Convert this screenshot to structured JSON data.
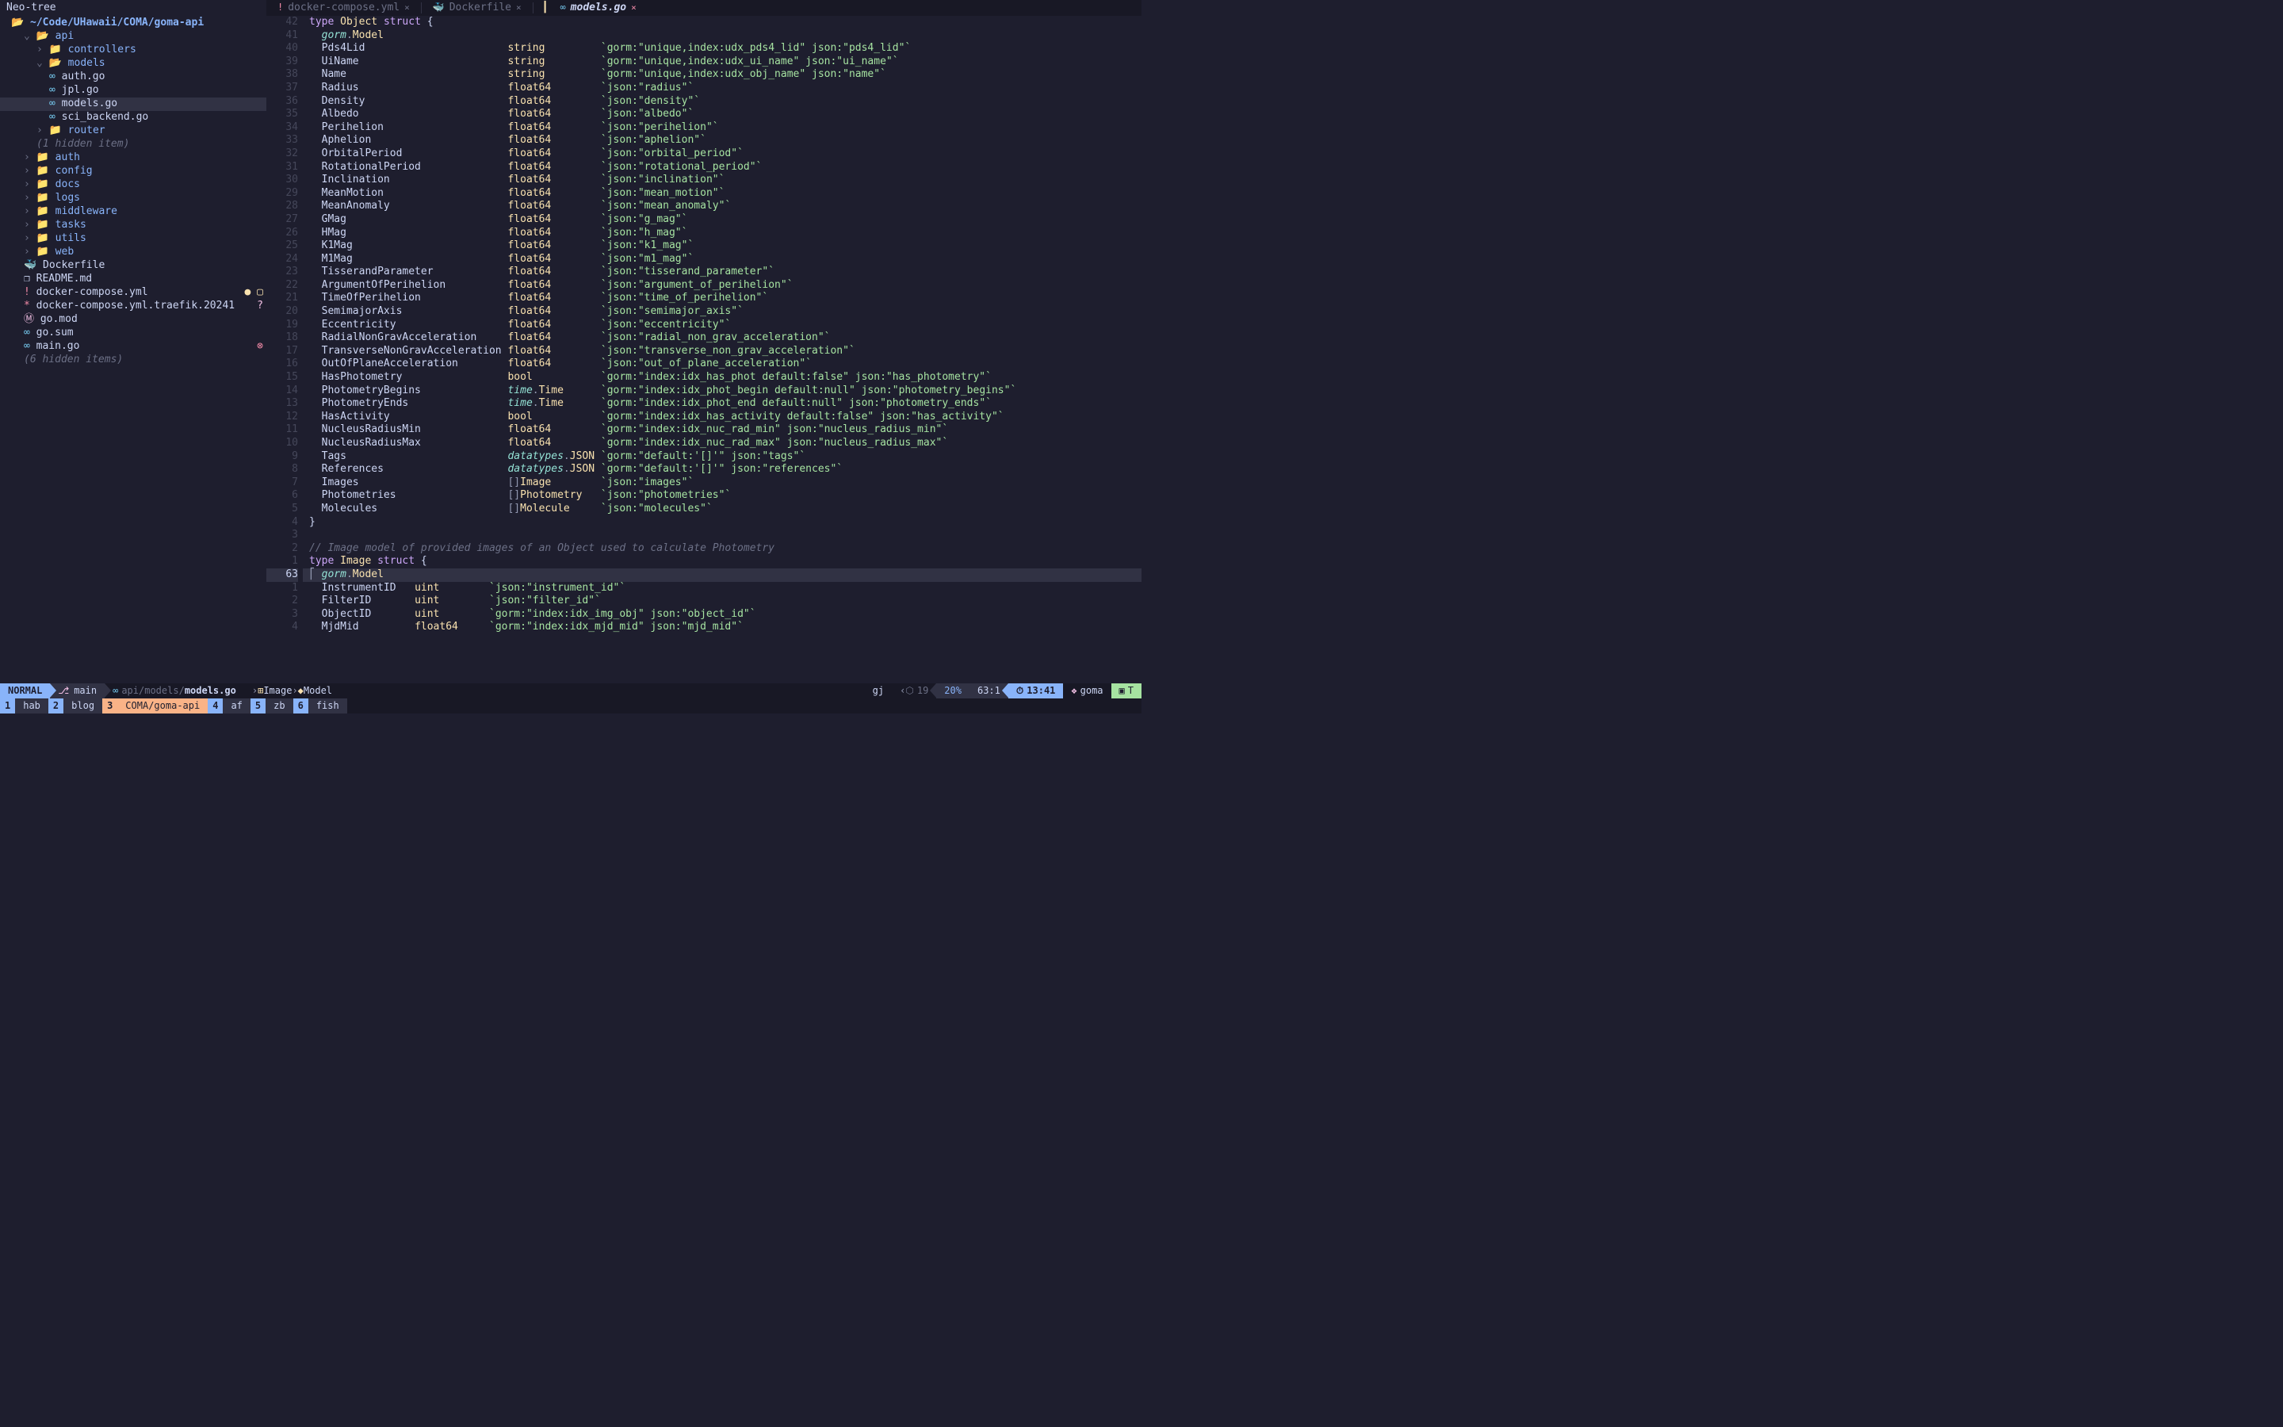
{
  "sidebar": {
    "title": "Neo-tree",
    "root": "~/Code/UHawaii/COMA/goma-api",
    "items": [
      {
        "depth": 1,
        "kind": "folder-open",
        "chev": "v",
        "label": "api"
      },
      {
        "depth": 2,
        "kind": "folder",
        "chev": ">",
        "label": "controllers"
      },
      {
        "depth": 2,
        "kind": "folder-open",
        "chev": "v",
        "label": "models"
      },
      {
        "depth": 3,
        "kind": "go",
        "label": "auth.go"
      },
      {
        "depth": 3,
        "kind": "go",
        "label": "jpl.go"
      },
      {
        "depth": 3,
        "kind": "go",
        "label": "models.go",
        "hl": true
      },
      {
        "depth": 3,
        "kind": "go",
        "label": "sci_backend.go"
      },
      {
        "depth": 2,
        "kind": "folder",
        "chev": ">",
        "label": "router"
      },
      {
        "depth": 2,
        "kind": "muted",
        "label": "(1 hidden item)"
      },
      {
        "depth": 1,
        "kind": "folder",
        "chev": ">",
        "label": "auth"
      },
      {
        "depth": 1,
        "kind": "folder",
        "chev": ">",
        "label": "config"
      },
      {
        "depth": 1,
        "kind": "folder",
        "chev": ">",
        "label": "docs"
      },
      {
        "depth": 1,
        "kind": "folder",
        "chev": ">",
        "label": "logs"
      },
      {
        "depth": 1,
        "kind": "folder",
        "chev": ">",
        "label": "middleware"
      },
      {
        "depth": 1,
        "kind": "folder",
        "chev": ">",
        "label": "tasks"
      },
      {
        "depth": 1,
        "kind": "folder",
        "chev": ">",
        "label": "utils"
      },
      {
        "depth": 1,
        "kind": "folder",
        "chev": ">",
        "label": "web"
      },
      {
        "depth": 1,
        "kind": "docker",
        "label": "Dockerfile"
      },
      {
        "depth": 1,
        "kind": "md",
        "label": "README.md",
        "icon": "❐"
      },
      {
        "depth": 1,
        "kind": "yml",
        "label": "docker-compose.yml",
        "icon": "!",
        "mark": "mod"
      },
      {
        "depth": 1,
        "kind": "yml",
        "label": "docker-compose.yml.traefik.20241",
        "icon": "*",
        "mark": "unt"
      },
      {
        "depth": 1,
        "kind": "mod",
        "label": "go.mod",
        "icon": "Ⓜ"
      },
      {
        "depth": 1,
        "kind": "go",
        "label": "go.sum"
      },
      {
        "depth": 1,
        "kind": "go",
        "label": "main.go",
        "mark": "del"
      },
      {
        "depth": 1,
        "kind": "muted",
        "label": "(6 hidden items)"
      }
    ]
  },
  "tabs": [
    {
      "icon": "!",
      "iconColor": "#f38ba8",
      "name": "docker-compose.yml",
      "close": "×",
      "active": false
    },
    {
      "icon": "🐳",
      "iconColor": "#89b4fa",
      "name": "Dockerfile",
      "close": "×",
      "active": false
    },
    {
      "icon": "∞",
      "iconColor": "#74c7ec",
      "name": "models.go",
      "close": "×",
      "active": true,
      "bar": "▎"
    }
  ],
  "gutter_lines": [
    "42",
    "41",
    "40",
    "39",
    "38",
    "37",
    "36",
    "35",
    "34",
    "33",
    "32",
    "31",
    "30",
    "29",
    "28",
    "27",
    "26",
    "25",
    "24",
    "23",
    "22",
    "21",
    "20",
    "19",
    "18",
    "17",
    "16",
    "15",
    "14",
    "13",
    "12",
    "11",
    "10",
    "9",
    "8",
    "7",
    "6",
    "5",
    "4",
    "3",
    "2",
    "1",
    "63",
    "1",
    "2",
    "3",
    "4"
  ],
  "cursor_line_index": 42,
  "code": {
    "header": "type Object struct {",
    "gorm_model": "gorm.Model",
    "fields": [
      {
        "n": "Pds4Lid",
        "t": "string",
        "tag": "`gorm:\"unique,index:udx_pds4_lid\" json:\"pds4_lid\"`"
      },
      {
        "n": "UiName",
        "t": "string",
        "tag": "`gorm:\"unique,index:udx_ui_name\" json:\"ui_name\"`"
      },
      {
        "n": "Name",
        "t": "string",
        "tag": "`gorm:\"unique,index:udx_obj_name\" json:\"name\"`"
      },
      {
        "n": "Radius",
        "t": "float64",
        "tag": "`json:\"radius\"`"
      },
      {
        "n": "Density",
        "t": "float64",
        "tag": "`json:\"density\"`"
      },
      {
        "n": "Albedo",
        "t": "float64",
        "tag": "`json:\"albedo\"`"
      },
      {
        "n": "Perihelion",
        "t": "float64",
        "tag": "`json:\"perihelion\"`"
      },
      {
        "n": "Aphelion",
        "t": "float64",
        "tag": "`json:\"aphelion\"`"
      },
      {
        "n": "OrbitalPeriod",
        "t": "float64",
        "tag": "`json:\"orbital_period\"`"
      },
      {
        "n": "RotationalPeriod",
        "t": "float64",
        "tag": "`json:\"rotational_period\"`"
      },
      {
        "n": "Inclination",
        "t": "float64",
        "tag": "`json:\"inclination\"`"
      },
      {
        "n": "MeanMotion",
        "t": "float64",
        "tag": "`json:\"mean_motion\"`"
      },
      {
        "n": "MeanAnomaly",
        "t": "float64",
        "tag": "`json:\"mean_anomaly\"`"
      },
      {
        "n": "GMag",
        "t": "float64",
        "tag": "`json:\"g_mag\"`"
      },
      {
        "n": "HMag",
        "t": "float64",
        "tag": "`json:\"h_mag\"`"
      },
      {
        "n": "K1Mag",
        "t": "float64",
        "tag": "`json:\"k1_mag\"`"
      },
      {
        "n": "M1Mag",
        "t": "float64",
        "tag": "`json:\"m1_mag\"`"
      },
      {
        "n": "TisserandParameter",
        "t": "float64",
        "tag": "`json:\"tisserand_parameter\"`"
      },
      {
        "n": "ArgumentOfPerihelion",
        "t": "float64",
        "tag": "`json:\"argument_of_perihelion\"`"
      },
      {
        "n": "TimeOfPerihelion",
        "t": "float64",
        "tag": "`json:\"time_of_perihelion\"`"
      },
      {
        "n": "SemimajorAxis",
        "t": "float64",
        "tag": "`json:\"semimajor_axis\"`"
      },
      {
        "n": "Eccentricity",
        "t": "float64",
        "tag": "`json:\"eccentricity\"`"
      },
      {
        "n": "RadialNonGravAcceleration",
        "t": "float64",
        "tag": "`json:\"radial_non_grav_acceleration\"`"
      },
      {
        "n": "TransverseNonGravAcceleration",
        "t": "float64",
        "tag": "`json:\"transverse_non_grav_acceleration\"`"
      },
      {
        "n": "OutOfPlaneAcceleration",
        "t": "float64",
        "tag": "`json:\"out_of_plane_acceleration\"`"
      },
      {
        "n": "HasPhotometry",
        "t": "bool",
        "tag": "`gorm:\"index:idx_has_phot default:false\" json:\"has_photometry\"`"
      },
      {
        "n": "PhotometryBegins",
        "t": "time.Time",
        "tag": "`gorm:\"index:idx_phot_begin default:null\" json:\"photometry_begins\"`"
      },
      {
        "n": "PhotometryEnds",
        "t": "time.Time",
        "tag": "`gorm:\"index:idx_phot_end default:null\" json:\"photometry_ends\"`"
      },
      {
        "n": "HasActivity",
        "t": "bool",
        "tag": "`gorm:\"index:idx_has_activity default:false\" json:\"has_activity\"`"
      },
      {
        "n": "NucleusRadiusMin",
        "t": "float64",
        "tag": "`gorm:\"index:idx_nuc_rad_min\" json:\"nucleus_radius_min\"`"
      },
      {
        "n": "NucleusRadiusMax",
        "t": "float64",
        "tag": "`gorm:\"index:idx_nuc_rad_max\" json:\"nucleus_radius_max\"`"
      },
      {
        "n": "Tags",
        "t": "datatypes.JSON",
        "tag": "`gorm:\"default:'[]'\" json:\"tags\"`"
      },
      {
        "n": "References",
        "t": "datatypes.JSON",
        "tag": "`gorm:\"default:'[]'\" json:\"references\"`"
      },
      {
        "n": "Images",
        "t": "[]Image",
        "tag": "`json:\"images\"`"
      },
      {
        "n": "Photometries",
        "t": "[]Photometry",
        "tag": "`json:\"photometries\"`"
      },
      {
        "n": "Molecules",
        "t": "[]Molecule",
        "tag": "`json:\"molecules\"`"
      }
    ],
    "close_brace": "}",
    "blank": "",
    "comment": "// Image model of provided images of an Object used to calculate Photometry",
    "image_header": "type Image struct {",
    "cursor_line": "  gorm.Model",
    "image_fields": [
      {
        "n": "InstrumentID",
        "t": "uint",
        "tag": "`json:\"instrument_id\"`"
      },
      {
        "n": "FilterID",
        "t": "uint",
        "tag": "`json:\"filter_id\"`"
      },
      {
        "n": "ObjectID",
        "t": "uint",
        "tag": "`gorm:\"index:idx_img_obj\" json:\"object_id\"`"
      },
      {
        "n": "MjdMid",
        "t": "float64",
        "tag": "`gorm:\"index:idx_mjd_mid\" json:\"mjd_mid\"`"
      }
    ]
  },
  "status": {
    "mode": "NORMAL",
    "branch_icon": "⎇",
    "branch": "main",
    "path_icon": "∞",
    "path_dir": "api/models/",
    "path_file": "models.go",
    "sym1_icon": "⊞",
    "sym1": "Image",
    "sym2_icon": "◆",
    "sym2": "Model",
    "gj": "gj",
    "copilot_icon": "⬡",
    "copilot": "19",
    "pct": "20%",
    "pos": "63:1",
    "time_icon": "⏱",
    "time": "13:41",
    "goma_icon": "❖",
    "goma": "goma",
    "term_icon": "▣",
    "term": "T"
  },
  "tmux": [
    {
      "num": "1",
      "name": "hab"
    },
    {
      "num": "2",
      "name": "blog"
    },
    {
      "num": "3",
      "name": "COMA/goma-api",
      "active": true
    },
    {
      "num": "4",
      "name": "af"
    },
    {
      "num": "5",
      "name": "zb"
    },
    {
      "num": "6",
      "name": "fish"
    }
  ]
}
